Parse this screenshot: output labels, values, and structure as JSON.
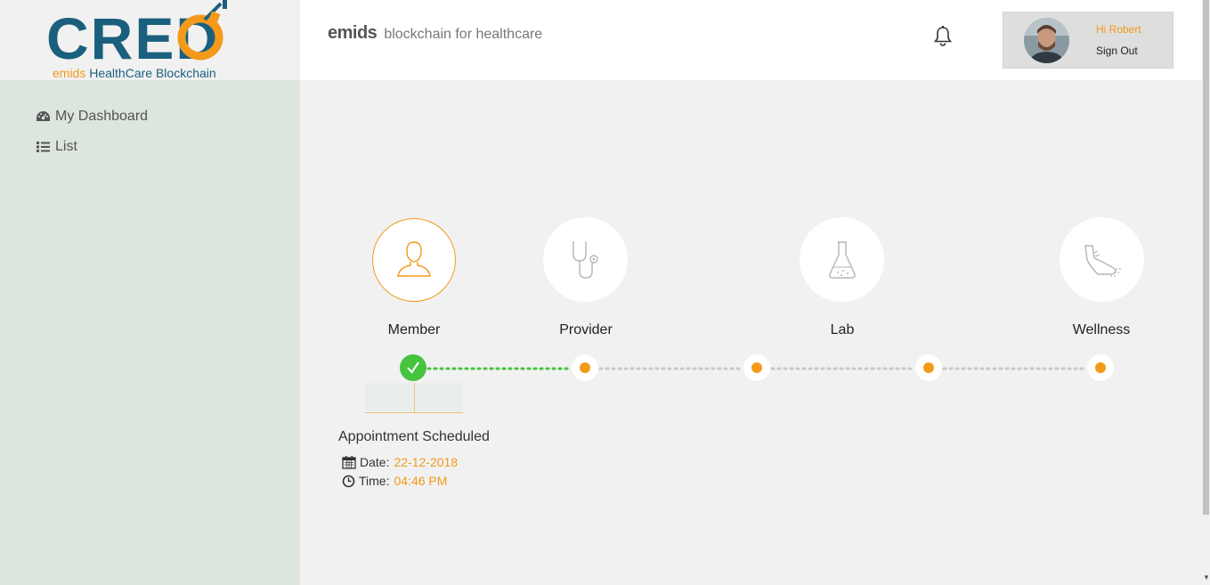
{
  "logo": {
    "brand": "CREDO",
    "subtitle_part1": "emids",
    "subtitle_part2": "HealthCare Blockchain"
  },
  "sidebar": {
    "items": [
      {
        "label": "My Dashboard",
        "icon": "dashboard-icon"
      },
      {
        "label": "List",
        "icon": "list-icon"
      }
    ]
  },
  "header": {
    "brand_name": "emids",
    "tagline": "blockchain for healthcare",
    "greeting": "Hi Robert",
    "sign_out": "Sign Out"
  },
  "steps": [
    {
      "label": "Member",
      "icon": "member-icon",
      "status": "active"
    },
    {
      "label": "Provider",
      "icon": "stethoscope-icon",
      "status": "pending"
    },
    {
      "label": "Lab",
      "icon": "flask-icon",
      "status": "pending"
    },
    {
      "label": "Wellness",
      "icon": "running-shoe-icon",
      "status": "pending"
    }
  ],
  "event": {
    "title": "Appointment Scheduled",
    "date_label": "Date:",
    "date_value": "22-12-2018",
    "time_label": "Time:",
    "time_value": "04:46 PM"
  },
  "colors": {
    "accent": "#f39a1b",
    "brand_blue": "#1b5f7e",
    "success": "#46c43e",
    "sidebar_bg": "#dce5de"
  }
}
